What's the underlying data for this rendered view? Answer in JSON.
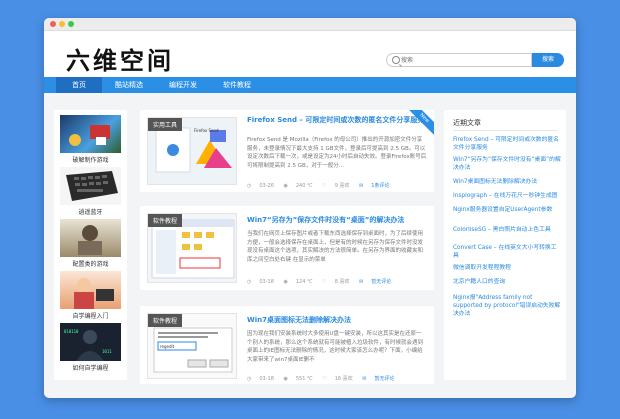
{
  "site": {
    "logo_text": "六维空间"
  },
  "search": {
    "placeholder": "搜索",
    "button_label": "搜索"
  },
  "nav": [
    {
      "label": "首页"
    },
    {
      "label": "酷站精选"
    },
    {
      "label": "编程开发"
    },
    {
      "label": "软件教程"
    }
  ],
  "left_panel": {
    "items": [
      {
        "label": "破解制作游戏"
      },
      {
        "label": "逍遥蓝牙"
      },
      {
        "label": "配置类的游戏"
      },
      {
        "label": "自学编程入门"
      },
      {
        "label": "如何自学编程"
      }
    ]
  },
  "articles": [
    {
      "tag": "实用工具",
      "title": "Firefox Send – 可限定时间或次数的匿名文件分享服务",
      "excerpt": "Firefox Send 是 Mozilla（Firefox 的母公司）推出的开源加密文件分享服务，未登录情况下最大支持 1 GB文件，登录后可提高到 2.5 GB。可以设定次数后下载一次，或是设定为24小时后自动失效。登录Firefox账号后可将限制提高到 2.5 GB，对于一般分...",
      "date": "03-26",
      "views": "240 ℃",
      "likes": "9 喜欢",
      "comments": "1条评论",
      "ribbon": "New"
    },
    {
      "tag": "软件教程",
      "title": "Win7“另存为”保存文件时没有“桌面”的解决办法",
      "excerpt": "当我们在网页上保存图片或者下载东西选择保存到桌面时，为了后续使用方便，一般会选择保存在桌面上，但是有的时候在另存为保存文件时没发现没有桌面这个选项，其实解决的方法很简单。在另存为界面的收藏夹和库之间空白处右键 在显示的菜单",
      "date": "03-18",
      "views": "124 ℃",
      "likes": "8 喜欢",
      "comments": "暂无评论"
    },
    {
      "tag": "软件教程",
      "title": "Win7桌面图标无法删除解决办法",
      "excerpt": "因为现在我们安装系统时大多使用U盘一键安装，所以这其实是在还原一个别人的系统，那么这个系统就有可能被植入垃圾软件，有时候就会遇到桌面上的IE图标无法删除的情况，这时候大家该怎么办呢？下面，小编给大家带来了win7桌面IE删不",
      "date": "03-18",
      "views": "551 ℃",
      "likes": "16 喜欢",
      "comments": "暂无评论"
    }
  ],
  "recent": {
    "title": "近期文章",
    "items": [
      "Firefox Send – 可限定时间或次数的匿名文件分享服务",
      "Win7“另存为”保存文件时没有“桌面”的解决办法",
      "Win7桌面图标无法删除解决办法",
      "Insplograph – 在线万花尺一秒钟生成图",
      "Nginx服务器设置自定UserAgent参数",
      "ColorliseSG – 黑白照片自动上色工具",
      "Convert Case – 在线英文大小写转换工具",
      "微信调取开发程程教程",
      "北京户籍人口的查询",
      "Nginx报\"Address family not supported by protocol\"错误启动失败解决办法"
    ]
  },
  "colors": {
    "accent": "#2b8fe6",
    "background": "#4a8fe6"
  }
}
